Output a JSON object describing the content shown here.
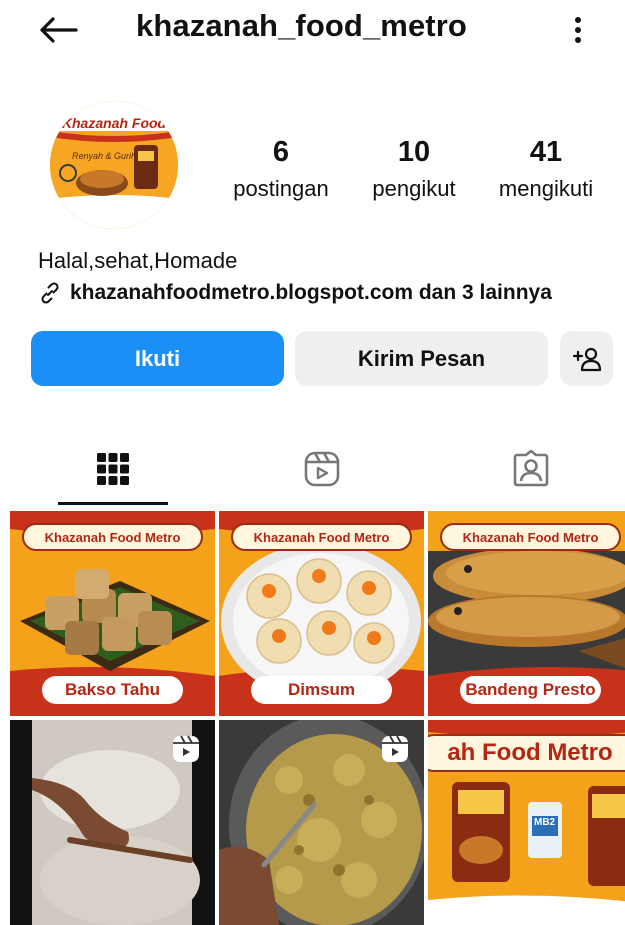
{
  "header": {
    "username": "khazanah_food_metro"
  },
  "profile": {
    "avatar_text": "Khazanah Food",
    "avatar_tagline": "Renyah & Gurih",
    "stats": [
      {
        "value": "6",
        "label": "postingan"
      },
      {
        "value": "10",
        "label": "pengikut"
      },
      {
        "value": "41",
        "label": "mengikuti"
      }
    ],
    "bio": "Halal,sehat,Homade",
    "link": "khazanahfoodmetro.blogspot.com dan 3 lainnya"
  },
  "actions": {
    "follow": "Ikuti",
    "message": "Kirim Pesan"
  },
  "tabs": [
    {
      "icon": "grid-icon",
      "active": true
    },
    {
      "icon": "reels-icon",
      "active": false
    },
    {
      "icon": "tagged-icon",
      "active": false
    }
  ],
  "posts": [
    {
      "banner": "Khazanah Food Metro",
      "caption": "Bakso Tahu",
      "type": "image"
    },
    {
      "banner": "Khazanah Food Metro",
      "caption": "Dimsum",
      "type": "image"
    },
    {
      "banner": "Khazanah Food Metro",
      "caption": "Bandeng Presto",
      "type": "image"
    },
    {
      "type": "reel"
    },
    {
      "type": "reel"
    },
    {
      "banner": "ah Food Metro",
      "type": "image",
      "badge": "MB2"
    }
  ],
  "colors": {
    "follow_button": "#1a8ff5",
    "secondary_button": "#efefef",
    "brand_red": "#b32613",
    "brand_orange": "#f4a21a"
  }
}
